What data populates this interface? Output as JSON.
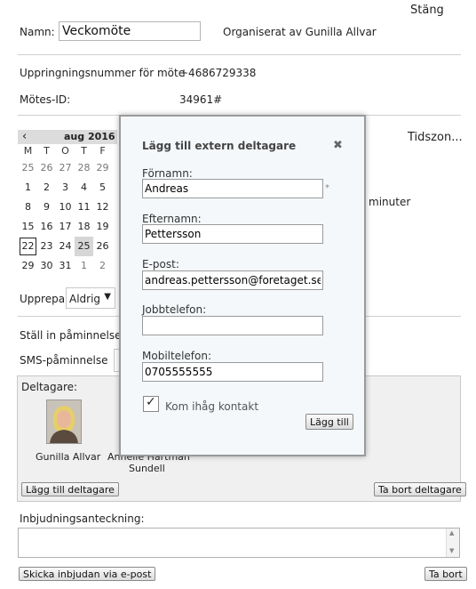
{
  "header": {
    "close_label": "Stäng"
  },
  "meeting": {
    "name_label": "Namn:",
    "name_value": "Veckomöte",
    "organizer": "Organiserat av Gunilla Allvar",
    "dial_label": "Uppringningsnummer för möte",
    "dial_value": "+4686729338",
    "id_label": "Mötes-ID:",
    "id_value": "34961#",
    "timezone_label": "Tidszon...",
    "minutes_label": "minuter"
  },
  "calendar": {
    "prev": "‹",
    "month_label": "aug 2016",
    "weekdays": [
      "M",
      "T",
      "O",
      "T",
      "F"
    ],
    "weeks": [
      [
        "25",
        "26",
        "27",
        "28",
        "29"
      ],
      [
        "1",
        "2",
        "3",
        "4",
        "5"
      ],
      [
        "8",
        "9",
        "10",
        "11",
        "12"
      ],
      [
        "15",
        "16",
        "17",
        "18",
        "19"
      ],
      [
        "22",
        "23",
        "24",
        "25",
        "26"
      ],
      [
        "29",
        "30",
        "31",
        "1",
        "2"
      ]
    ]
  },
  "repeat": {
    "label": "Upprepa:",
    "value": "Aldrig"
  },
  "reminder": {
    "label": "Ställ in påminnelse",
    "sms_label": "SMS-påminnelse"
  },
  "participants": {
    "label": "Deltagare:",
    "list": [
      {
        "name": "Gunilla Allvar"
      },
      {
        "name": "Annelie Hartman",
        "name2": "Sundell"
      }
    ],
    "add_button": "Lägg till deltagare",
    "remove_button": "Ta bort deltagare"
  },
  "note": {
    "label": "Inbjudningsanteckning:"
  },
  "footer": {
    "send_button": "Skicka inbjudan via e-post",
    "delete_button": "Ta bort"
  },
  "dialog": {
    "title": "Lägg till extern deltagare",
    "close_symbol": "✖",
    "first_name_label": "Förnamn:",
    "first_name_value": "Andreas",
    "required_mark": "*",
    "last_name_label": "Efternamn:",
    "last_name_value": "Pettersson",
    "email_label": "E-post:",
    "email_value": "andreas.pettersson@foretaget.se",
    "work_phone_label": "Jobbtelefon:",
    "work_phone_value": "",
    "mobile_label": "Mobiltelefon:",
    "mobile_value": "0705555555",
    "remember_label": "Kom ihåg kontakt",
    "remember_checked": true,
    "add_button": "Lägg till"
  }
}
